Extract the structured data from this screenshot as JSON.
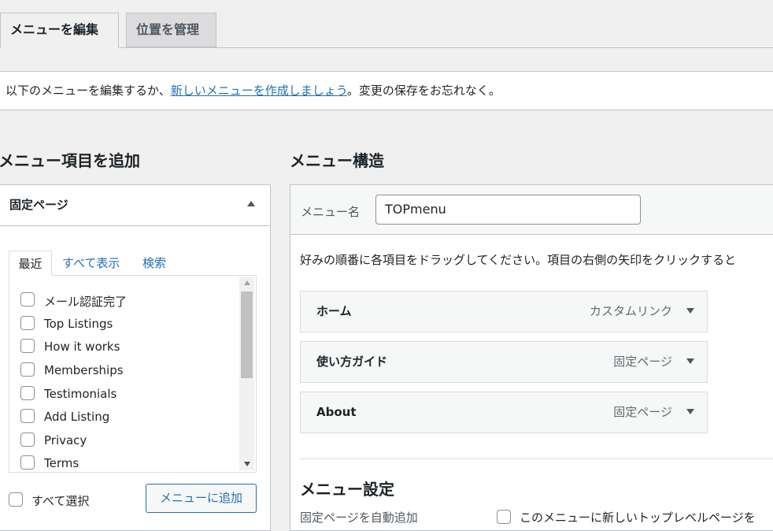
{
  "tabs": {
    "edit": "メニューを編集",
    "locations": "位置を管理"
  },
  "notice": {
    "before": "以下のメニューを編集するか、",
    "link": "新しいメニューを作成しましょう",
    "after": "。変更の保存をお忘れなく。"
  },
  "left": {
    "heading": "メニュー項目を追加",
    "panel_title": "固定ページ",
    "subtabs": {
      "recent": "最近",
      "all": "すべて表示",
      "search": "検索"
    },
    "items": [
      "メール認証完了",
      "Top Listings",
      "How it works",
      "Memberships",
      "Testimonials",
      "Add Listing",
      "Privacy",
      "Terms"
    ],
    "select_all": "すべて選択",
    "add_button": "メニューに追加"
  },
  "right": {
    "heading": "メニュー構造",
    "menu_name_label": "メニュー名",
    "menu_name_value": "TOPmenu",
    "instructions": "好みの順番に各項目をドラッグしてください。項目の右側の矢印をクリックすると",
    "menu_items": [
      {
        "title": "ホーム",
        "type": "カスタムリンク"
      },
      {
        "title": "使い方ガイド",
        "type": "固定ページ"
      },
      {
        "title": "About",
        "type": "固定ページ"
      }
    ],
    "settings_heading": "メニュー設定",
    "auto_add_label": "固定ページを自動追加",
    "auto_add_option": "このメニューに新しいトップレベルページを"
  }
}
